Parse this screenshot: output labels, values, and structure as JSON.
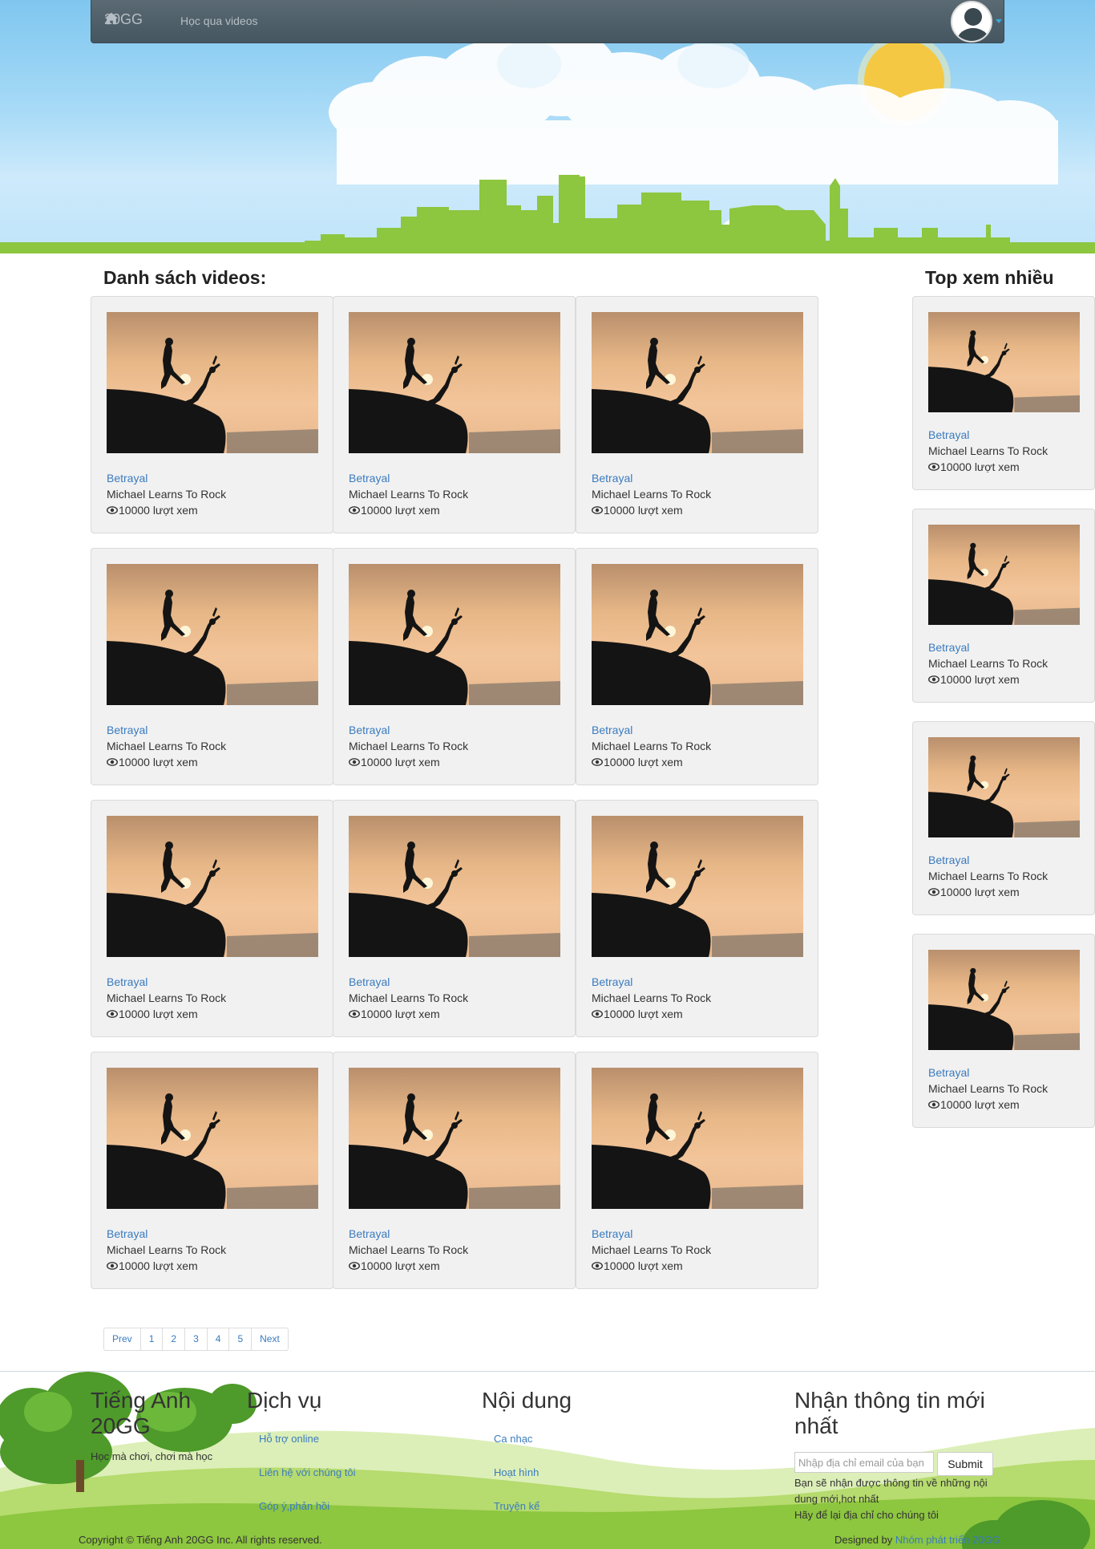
{
  "navbar": {
    "brand": "20GG",
    "link": "Học qua videos"
  },
  "main": {
    "list_title": "Danh sách videos:",
    "videos": [
      {
        "title": "Betrayal",
        "artist": "Michael Learns To Rock",
        "views": "10000 lượt xem"
      },
      {
        "title": "Betrayal",
        "artist": "Michael Learns To Rock",
        "views": "10000 lượt xem"
      },
      {
        "title": "Betrayal",
        "artist": "Michael Learns To Rock",
        "views": "10000 lượt xem"
      },
      {
        "title": "Betrayal",
        "artist": "Michael Learns To Rock",
        "views": "10000 lượt xem"
      },
      {
        "title": "Betrayal",
        "artist": "Michael Learns To Rock",
        "views": "10000 lượt xem"
      },
      {
        "title": "Betrayal",
        "artist": "Michael Learns To Rock",
        "views": "10000 lượt xem"
      },
      {
        "title": "Betrayal",
        "artist": "Michael Learns To Rock",
        "views": "10000 lượt xem"
      },
      {
        "title": "Betrayal",
        "artist": "Michael Learns To Rock",
        "views": "10000 lượt xem"
      },
      {
        "title": "Betrayal",
        "artist": "Michael Learns To Rock",
        "views": "10000 lượt xem"
      },
      {
        "title": "Betrayal",
        "artist": "Michael Learns To Rock",
        "views": "10000 lượt xem"
      },
      {
        "title": "Betrayal",
        "artist": "Michael Learns To Rock",
        "views": "10000 lượt xem"
      },
      {
        "title": "Betrayal",
        "artist": "Michael Learns To Rock",
        "views": "10000 lượt xem"
      }
    ]
  },
  "sidebar": {
    "title": "Top xem nhiều",
    "videos": [
      {
        "title": "Betrayal",
        "artist": "Michael Learns To Rock",
        "views": "10000 lượt xem"
      },
      {
        "title": "Betrayal",
        "artist": "Michael Learns To Rock",
        "views": "10000 lượt xem"
      },
      {
        "title": "Betrayal",
        "artist": "Michael Learns To Rock",
        "views": "10000 lượt xem"
      },
      {
        "title": "Betrayal",
        "artist": "Michael Learns To Rock",
        "views": "10000 lượt xem"
      }
    ]
  },
  "pagination": {
    "prev": "Prev",
    "pages": [
      "1",
      "2",
      "3",
      "4",
      "5"
    ],
    "next": "Next"
  },
  "footer": {
    "brand_title": "Tiếng Anh 20GG",
    "brand_tagline": "Học mà chơi, chơi mà học",
    "services_title": "Dịch vụ",
    "services": [
      "Hỗ trợ online",
      "Liên hệ với chúng tôi",
      "Góp ý,phản hồi"
    ],
    "content_title": "Nội dung",
    "content": [
      "Ca nhạc",
      "Hoạt hình",
      "Truyện kể"
    ],
    "newsletter_title": "Nhận thông tin mới nhất",
    "email_placeholder": "Nhập địa chỉ email của bạn",
    "submit": "Submit",
    "newsletter_note": "Bạn sẽ nhận được thông tin về những nội dung mới,hot nhất",
    "newsletter_note2": "Hãy để lại địa chỉ cho chúng tôi",
    "copyright": "Copyright © Tiếng Anh 20GG Inc. All rights reserved.",
    "designed_by": "Designed by",
    "designer": "Nhóm phát triển 20GG"
  },
  "colors": {
    "link": "#3a7bbf",
    "navbar": "#4e5e67",
    "grass": "#8dc63f",
    "sun": "#f4c842"
  },
  "icons": [
    "home-icon",
    "avatar-icon",
    "eye-icon",
    "chevron-down-icon"
  ]
}
